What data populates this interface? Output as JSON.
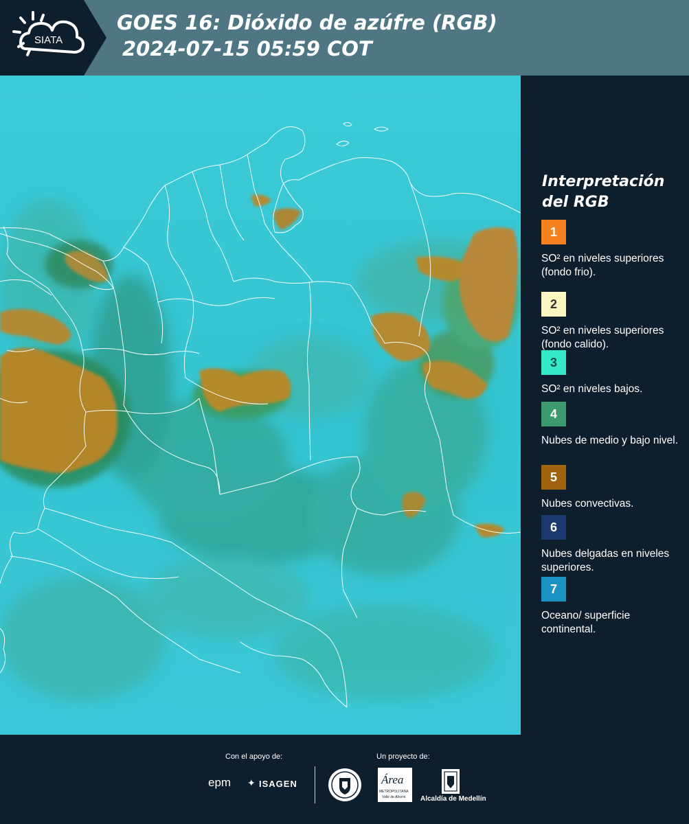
{
  "header": {
    "logo_text": "SIATA",
    "title_line1": "GOES 16: Dióxido de azúfre (RGB)",
    "title_line2": "2024-07-15 05:59 COT"
  },
  "legend": {
    "title": "Interpretación del RGB",
    "items": [
      {
        "number": "1",
        "label": "SO² en niveles superiores (fondo frio).",
        "color": "#f5821f",
        "text_color": "#ffffff"
      },
      {
        "number": "2",
        "label": "SO² en niveles superiores (fondo calido).",
        "color": "#fdf6c3",
        "text_color": "#333333"
      },
      {
        "number": "3",
        "label": "SO² en niveles bajos.",
        "color": "#34e8c8",
        "text_color": "#1a4a4a"
      },
      {
        "number": "4",
        "label": "Nubes de medio y bajo nivel.",
        "color": "#3c9a6c",
        "text_color": "#ffffff"
      },
      {
        "number": "5",
        "label": "Nubes convectivas.",
        "color": "#a0640e",
        "text_color": "#ffffff"
      },
      {
        "number": "6",
        "label": "Nubes delgadas en niveles superiores.",
        "color": "#1a3a6e",
        "text_color": "#ffffff"
      },
      {
        "number": "7",
        "label": "Oceano/ superficie continental.",
        "color": "#1d93c4",
        "text_color": "#ffffff"
      }
    ]
  },
  "footer": {
    "support_caption": "Con el apoyo de:",
    "project_caption": "Un proyecto de:",
    "sponsor_epm": "epm",
    "sponsor_isagen": "ISAGEN",
    "area_logo_text": "Área",
    "area_sub": "METROPOLITANA",
    "area_sub2": "Valle de Aburrá",
    "alcaldia": "Alcaldía de Medellín"
  },
  "colors": {
    "header_bg": "#4f7683",
    "panel_bg": "#0d1e2c",
    "map_base": "#35c9d6",
    "cloud_orange": "#b38a2c",
    "cloud_green": "#2f9f92"
  }
}
